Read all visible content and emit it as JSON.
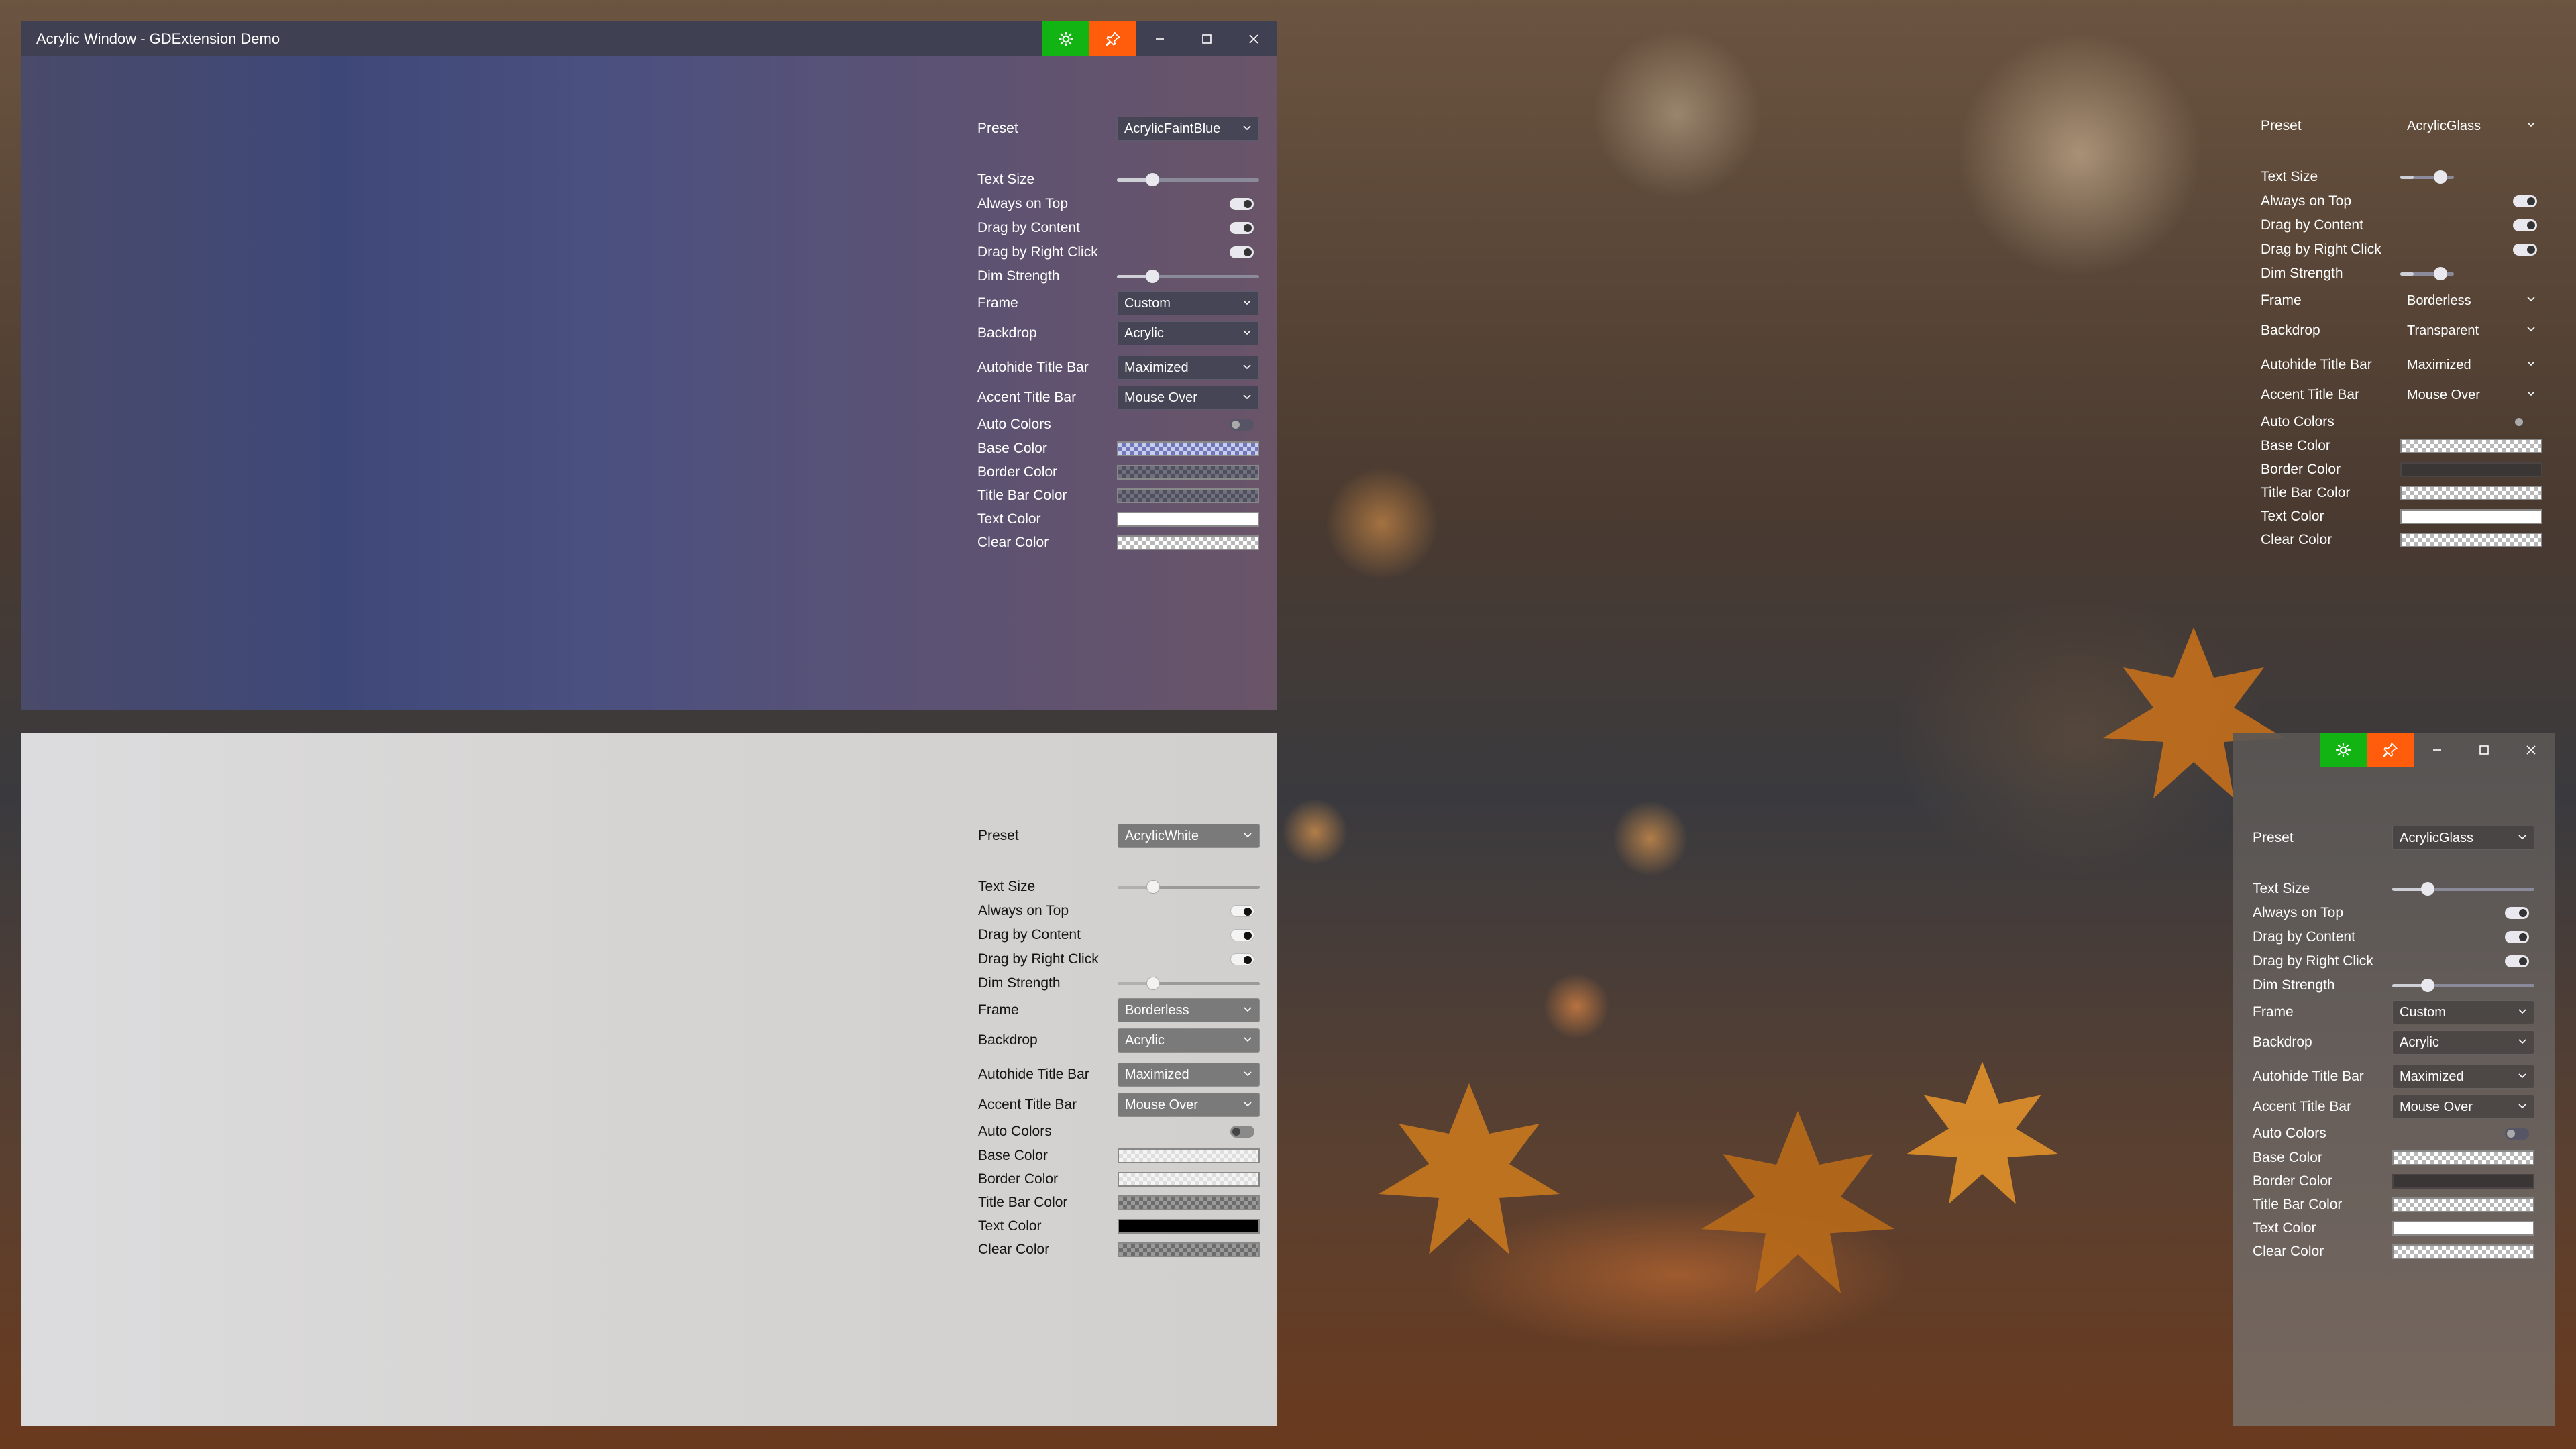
{
  "windows": {
    "purple": {
      "title": "Acrylic Window - GDExtension Demo",
      "settings": {
        "preset_label": "Preset",
        "preset_value": "AcrylicFaintBlue",
        "text_size_label": "Text Size",
        "always_on_top_label": "Always on Top",
        "drag_by_content_label": "Drag by Content",
        "drag_by_right_click_label": "Drag by Right Click",
        "dim_strength_label": "Dim Strength",
        "frame_label": "Frame",
        "frame_value": "Custom",
        "backdrop_label": "Backdrop",
        "backdrop_value": "Acrylic",
        "autohide_label": "Autohide Title Bar",
        "autohide_value": "Maximized",
        "accent_label": "Accent Title Bar",
        "accent_value": "Mouse Over",
        "auto_colors_label": "Auto Colors",
        "base_color_label": "Base Color",
        "border_color_label": "Border Color",
        "title_bar_color_label": "Title Bar Color",
        "text_color_label": "Text Color",
        "clear_color_label": "Clear Color"
      }
    },
    "white": {
      "settings": {
        "preset_label": "Preset",
        "preset_value": "AcrylicWhite",
        "text_size_label": "Text Size",
        "always_on_top_label": "Always on Top",
        "drag_by_content_label": "Drag by Content",
        "drag_by_right_click_label": "Drag by Right Click",
        "dim_strength_label": "Dim Strength",
        "frame_label": "Frame",
        "frame_value": "Borderless",
        "backdrop_label": "Backdrop",
        "backdrop_value": "Acrylic",
        "autohide_label": "Autohide Title Bar",
        "autohide_value": "Maximized",
        "accent_label": "Accent Title Bar",
        "accent_value": "Mouse Over",
        "auto_colors_label": "Auto Colors",
        "base_color_label": "Base Color",
        "border_color_label": "Border Color",
        "title_bar_color_label": "Title Bar Color",
        "text_color_label": "Text Color",
        "clear_color_label": "Clear Color"
      }
    },
    "transparent": {
      "settings": {
        "preset_label": "Preset",
        "preset_value": "AcrylicGlass",
        "text_size_label": "Text Size",
        "always_on_top_label": "Always on Top",
        "drag_by_content_label": "Drag by Content",
        "drag_by_right_click_label": "Drag by Right Click",
        "dim_strength_label": "Dim Strength",
        "frame_label": "Frame",
        "frame_value": "Borderless",
        "backdrop_label": "Backdrop",
        "backdrop_value": "Transparent",
        "autohide_label": "Autohide Title Bar",
        "autohide_value": "Maximized",
        "accent_label": "Accent Title Bar",
        "accent_value": "Mouse Over",
        "auto_colors_label": "Auto Colors",
        "base_color_label": "Base Color",
        "border_color_label": "Border Color",
        "title_bar_color_label": "Title Bar Color",
        "text_color_label": "Text Color",
        "clear_color_label": "Clear Color"
      }
    },
    "glass": {
      "settings": {
        "preset_label": "Preset",
        "preset_value": "AcrylicGlass",
        "text_size_label": "Text Size",
        "always_on_top_label": "Always on Top",
        "drag_by_content_label": "Drag by Content",
        "drag_by_right_click_label": "Drag by Right Click",
        "dim_strength_label": "Dim Strength",
        "frame_label": "Frame",
        "frame_value": "Custom",
        "backdrop_label": "Backdrop",
        "backdrop_value": "Acrylic",
        "autohide_label": "Autohide Title Bar",
        "autohide_value": "Maximized",
        "accent_label": "Accent Title Bar",
        "accent_value": "Mouse Over",
        "auto_colors_label": "Auto Colors",
        "base_color_label": "Base Color",
        "border_color_label": "Border Color",
        "title_bar_color_label": "Title Bar Color",
        "text_color_label": "Text Color",
        "clear_color_label": "Clear Color"
      }
    }
  },
  "slider_values": {
    "text_size": 0.25,
    "dim_strength": 0.25
  },
  "colors": {
    "settings_button": "#12b414",
    "pin_button": "#ff5c0c",
    "title_bar": "#3f4052"
  },
  "icons": {
    "settings": "gear-icon",
    "pin": "pin-icon",
    "minimize": "minimize-icon",
    "maximize": "maximize-icon",
    "close": "close-icon"
  }
}
